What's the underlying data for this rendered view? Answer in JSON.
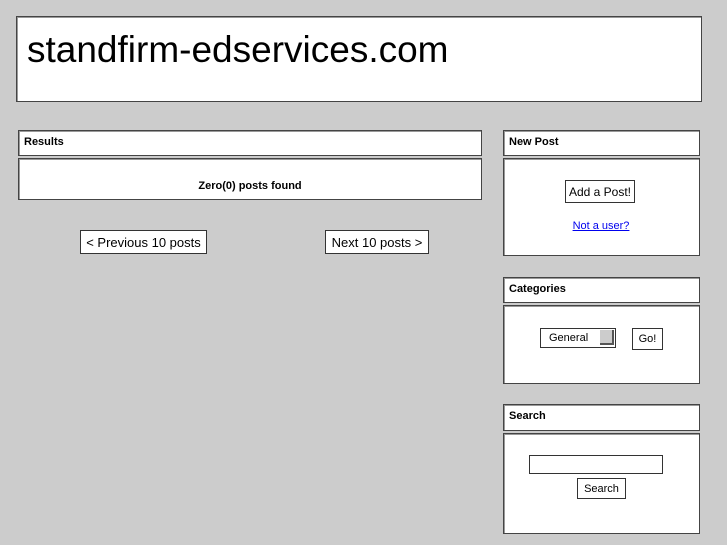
{
  "site_title": "standfirm-edservices.com",
  "results": {
    "header": "Results",
    "message": "Zero(0) posts found",
    "prev_label": "< Previous 10 posts",
    "next_label": "Next 10 posts >"
  },
  "new_post": {
    "header": "New Post",
    "add_label": "Add a Post!",
    "link_label": "Not a user?"
  },
  "categories": {
    "header": "Categories",
    "selected": "General",
    "go_label": "Go!"
  },
  "search": {
    "header": "Search",
    "input_value": "",
    "button_label": "Search"
  }
}
